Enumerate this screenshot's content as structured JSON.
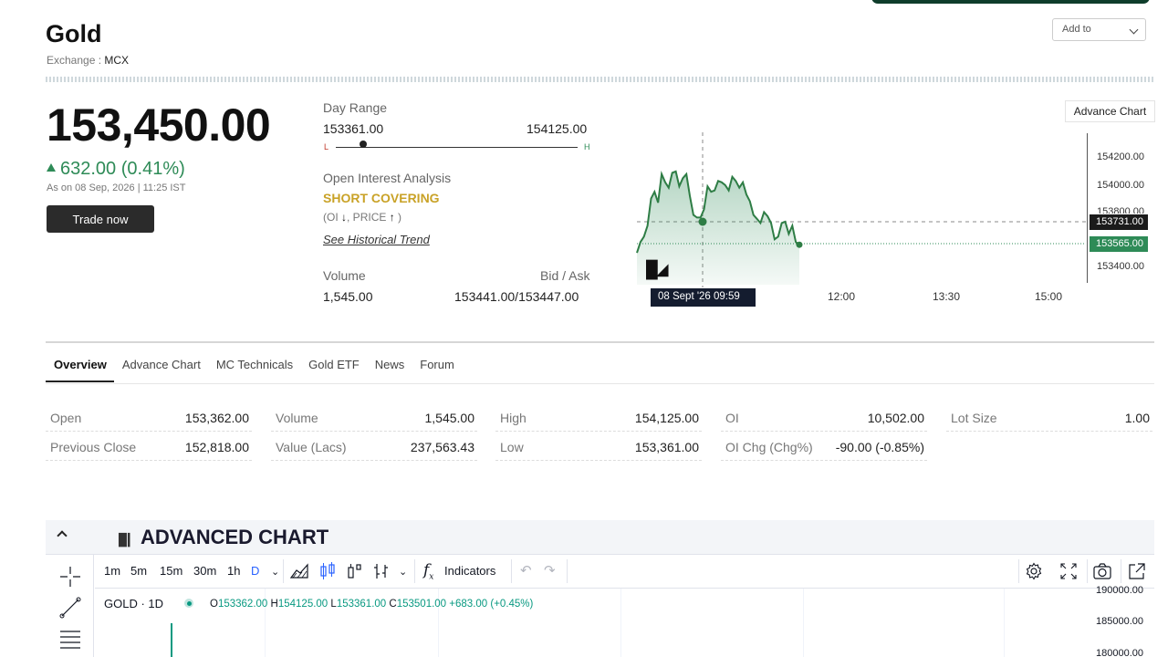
{
  "header": {
    "title": "Gold",
    "exchange_label": "Exchange :",
    "exchange_value": "MCX",
    "add_to_label": "Add to"
  },
  "quote": {
    "price": "153,450.00",
    "change": "632.00 (0.41%)",
    "as_on": "As on 08 Sep, 2026 | 11:25 IST",
    "trade_button": "Trade now",
    "advance_chart_button": "Advance Chart"
  },
  "day_range": {
    "label": "Day Range",
    "low": "153361.00",
    "high": "154125.00",
    "low_marker": "L",
    "high_marker": "H"
  },
  "oi_analysis": {
    "label": "Open Interest Analysis",
    "signal": "SHORT COVERING",
    "detail_open": "(OI",
    "detail_mid": ", PRICE",
    "detail_close": ")",
    "link": "See Historical Trend"
  },
  "volume_block": {
    "volume_label": "Volume",
    "volume_value": "1,545.00",
    "bidask_label": "Bid / Ask",
    "bidask_value": "153441.00/153447.00"
  },
  "chart_data": {
    "type": "area",
    "y_ticks": [
      "154200.00",
      "154000.00",
      "153800.00",
      "153400.00"
    ],
    "price_tags": [
      "153731.00",
      "153565.00"
    ],
    "crosshair_time": "08 Sept '26   09:59",
    "x_ticks": [
      "12:00",
      "13:30",
      "15:00"
    ],
    "ylim": [
      153300,
      154300
    ],
    "values": [
      153500,
      153580,
      153620,
      153700,
      153900,
      153950,
      153870,
      154080,
      154020,
      153980,
      154090,
      154100,
      153990,
      154050,
      154080,
      153920,
      153780,
      153760,
      153760,
      153820,
      153990,
      153950,
      153960,
      154030,
      154020,
      154000,
      153960,
      154060,
      154030,
      153980,
      154020,
      153930,
      153880,
      153780,
      153750,
      153720,
      153800,
      153770,
      153720,
      153600,
      153620,
      153720,
      153730,
      153640,
      153700,
      153580,
      153560
    ]
  },
  "tabs": [
    "Overview",
    "Advance Chart",
    "MC Technicals",
    "Gold ETF",
    "News",
    "Forum"
  ],
  "stats": {
    "open_k": "Open",
    "open_v": "153,362.00",
    "prev_k": "Previous Close",
    "prev_v": "152,818.00",
    "vol_k": "Volume",
    "vol_v": "1,545.00",
    "val_k": "Value (Lacs)",
    "val_v": "237,563.43",
    "high_k": "High",
    "high_v": "154,125.00",
    "low_k": "Low",
    "low_v": "153,361.00",
    "oi_k": "OI",
    "oi_v": "10,502.00",
    "oichg_k": "OI Chg (Chg%)",
    "oichg_v": "-90.00 (-0.85%)",
    "lot_k": "Lot Size",
    "lot_v": "1.00"
  },
  "advanced": {
    "title": "ADVANCED CHART",
    "timeframes": [
      "1m",
      "5m",
      "15m",
      "30m",
      "1h",
      "D"
    ],
    "indicators": "Indicators",
    "symbol": "GOLD · 1D",
    "o_label": "O",
    "o_value": "153362.00",
    "h_label": "H",
    "h_value": "154125.00",
    "l_label": "L",
    "l_value": "153361.00",
    "c_label": "C",
    "c_value": "153501.00",
    "change": "+683.00 (+0.45%)",
    "y_ticks": [
      "190000.00",
      "185000.00",
      "180000.00"
    ]
  },
  "colors": {
    "accent_green": "#2e8b57",
    "signal_gold": "#c9a227",
    "tv_green": "#089981",
    "tv_blue": "#2962ff"
  }
}
